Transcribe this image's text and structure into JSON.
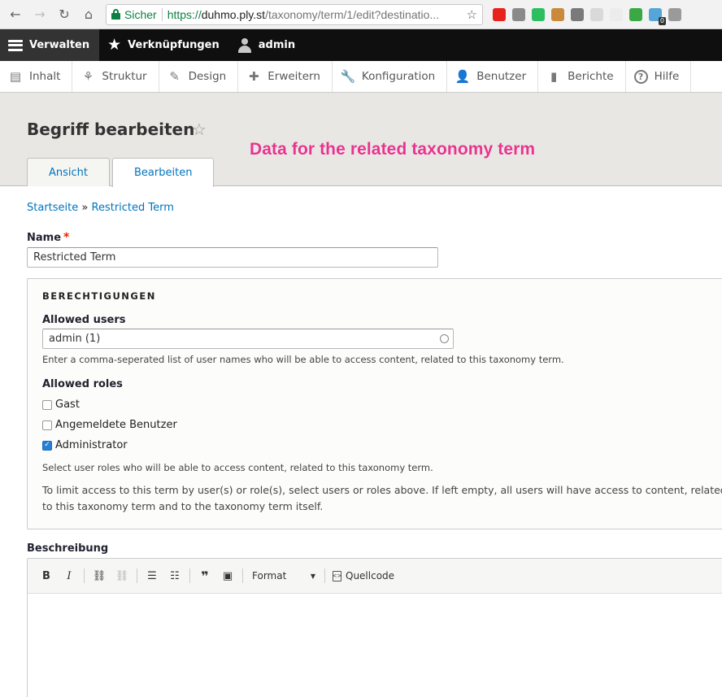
{
  "browser": {
    "secure_label": "Sicher",
    "url_scheme": "https://",
    "url_host": "duhmo.ply.st",
    "url_path": "/taxonomy/term/1/edit?destinatio...",
    "extensions": [
      {
        "name": "opera-icon",
        "color": "#e8211c"
      },
      {
        "name": "settings-ext-icon",
        "color": "#8a8a8a"
      },
      {
        "name": "evernote-ext-icon",
        "color": "#2dbe60"
      },
      {
        "name": "cookie-ext-icon",
        "color": "#c98a3c"
      },
      {
        "name": "recycle-ext-icon",
        "color": "#7a7a7a"
      },
      {
        "name": "feather-ext-icon",
        "color": "#d9d9d9"
      },
      {
        "name": "blank-ext-icon",
        "color": "#ececec"
      },
      {
        "name": "sync-ext-icon",
        "color": "#3aa845"
      },
      {
        "name": "badge-ext-icon",
        "color": "#55a6d6",
        "badge": "0"
      },
      {
        "name": "share-ext-icon",
        "color": "#9a9a9a"
      }
    ]
  },
  "toolbar": {
    "manage": "Verwalten",
    "shortcuts": "Verknüpfungen",
    "user": "admin"
  },
  "tray": {
    "items": [
      {
        "label": "Inhalt",
        "icon": "content-icon",
        "glyph": "▤"
      },
      {
        "label": "Struktur",
        "icon": "structure-icon",
        "glyph": "⚘"
      },
      {
        "label": "Design",
        "icon": "design-icon",
        "glyph": "✎"
      },
      {
        "label": "Erweitern",
        "icon": "extend-icon",
        "glyph": "✚"
      },
      {
        "label": "Konfiguration",
        "icon": "wrench-icon",
        "glyph": "🔧"
      },
      {
        "label": "Benutzer",
        "icon": "people-icon",
        "glyph": "👤"
      },
      {
        "label": "Berichte",
        "icon": "reports-icon",
        "glyph": "▮"
      },
      {
        "label": "Hilfe",
        "icon": "help-icon",
        "glyph": "?"
      }
    ]
  },
  "page": {
    "title": "Begriff bearbeiten",
    "annotation": "Data for the related taxonomy term",
    "tabs": [
      "Ansicht",
      "Bearbeiten"
    ],
    "breadcrumb": {
      "home": "Startseite",
      "sep": "»",
      "current": "Restricted Term"
    }
  },
  "form": {
    "name_label": "Name",
    "required_mark": "*",
    "name_value": "Restricted Term",
    "permissions": {
      "legend": "BERECHTIGUNGEN",
      "users_label": "Allowed users",
      "users_value": "admin (1)",
      "users_desc": "Enter a comma-seperated list of user names who will be able to access content, related to this taxonomy term.",
      "roles_label": "Allowed roles",
      "roles": [
        {
          "label": "Gast",
          "checked": false
        },
        {
          "label": "Angemeldete Benutzer",
          "checked": false
        },
        {
          "label": "Administrator",
          "checked": true
        }
      ],
      "roles_desc": "Select user roles who will be able to access content, related to this taxonomy term.",
      "note": "To limit access to this term by user(s) or role(s), select users or roles above. If left empty, all users will have access to content, related to this taxonomy term and to the taxonomy term itself."
    },
    "description_label": "Beschreibung",
    "editor": {
      "bold": "B",
      "italic": "I",
      "format": "Format",
      "source": "Quellcode"
    }
  }
}
